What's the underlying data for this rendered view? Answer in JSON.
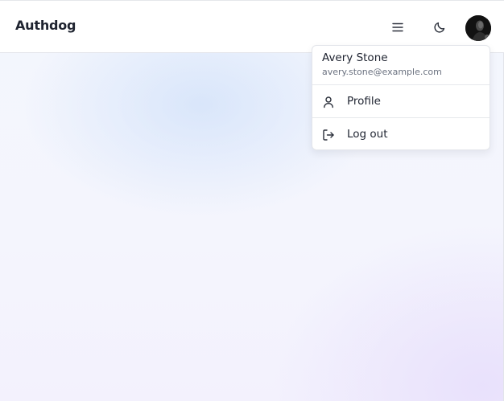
{
  "header": {
    "brand": "Authdog",
    "menu_icon": "hamburger-menu-icon",
    "theme_icon": "moon-icon"
  },
  "user_menu": {
    "name": "Avery Stone",
    "email": "avery.stone@example.com",
    "items": [
      {
        "label": "Profile",
        "icon": "user-icon"
      },
      {
        "label": "Log out",
        "icon": "logout-icon"
      }
    ]
  },
  "colors": {
    "text_primary": "#1e2330",
    "text_muted": "#6b7280",
    "border": "#e3e5ea"
  }
}
